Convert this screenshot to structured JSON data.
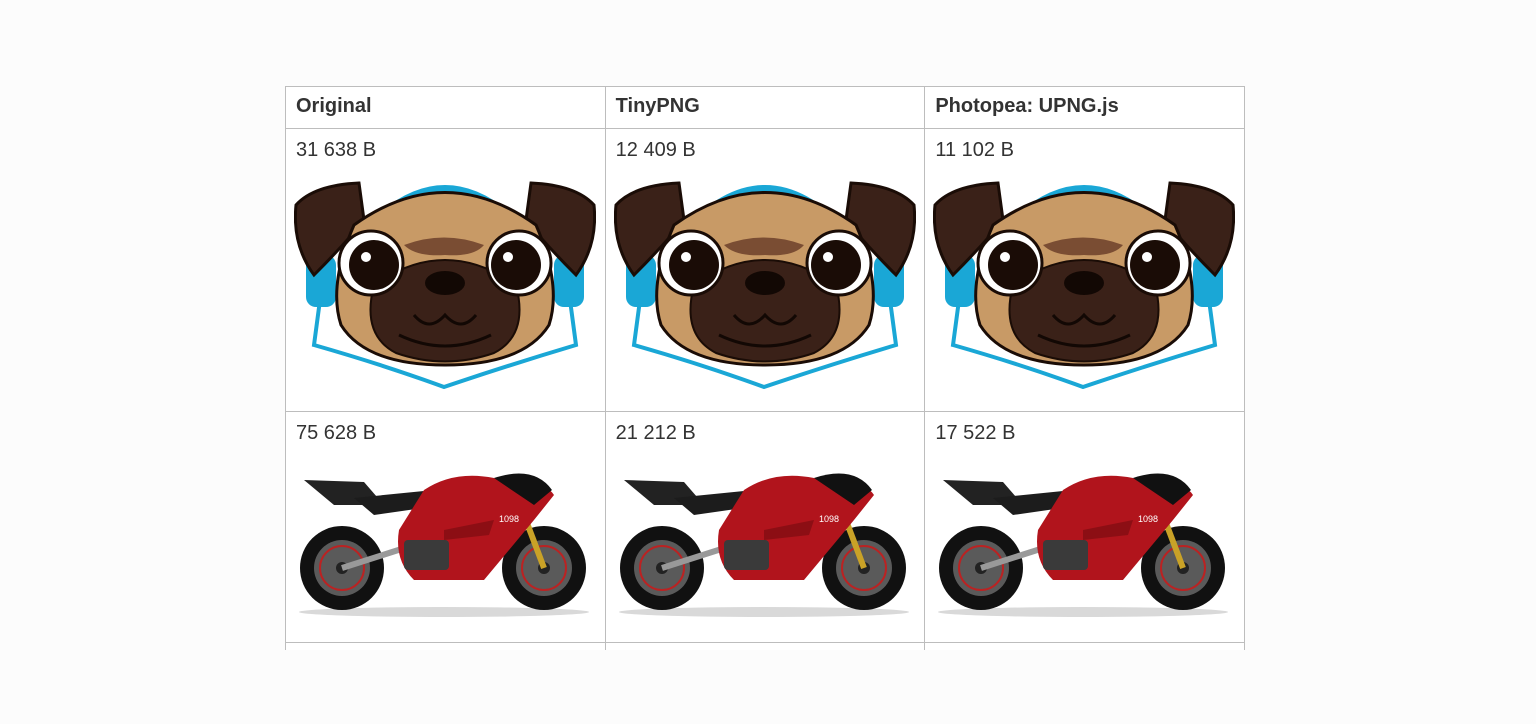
{
  "table": {
    "headers": [
      "Original",
      "TinyPNG",
      "Photopea: UPNG.js"
    ],
    "rows": [
      {
        "image": "pug-headphones-image",
        "sizes": [
          "31 638 B",
          "12 409 B",
          "11 102 B"
        ]
      },
      {
        "image": "red-motorcycle-image",
        "sizes": [
          "75 628 B",
          "21 212 B",
          "17 522 B"
        ]
      }
    ]
  },
  "colors": {
    "page_background": "#fcfcfc",
    "border": "#bdbdbd",
    "text": "#333333",
    "pug_fur": "#c89a66",
    "pug_dark": "#3a2118",
    "headphone_blue": "#1aa7d6",
    "bike_red": "#b1141c"
  }
}
